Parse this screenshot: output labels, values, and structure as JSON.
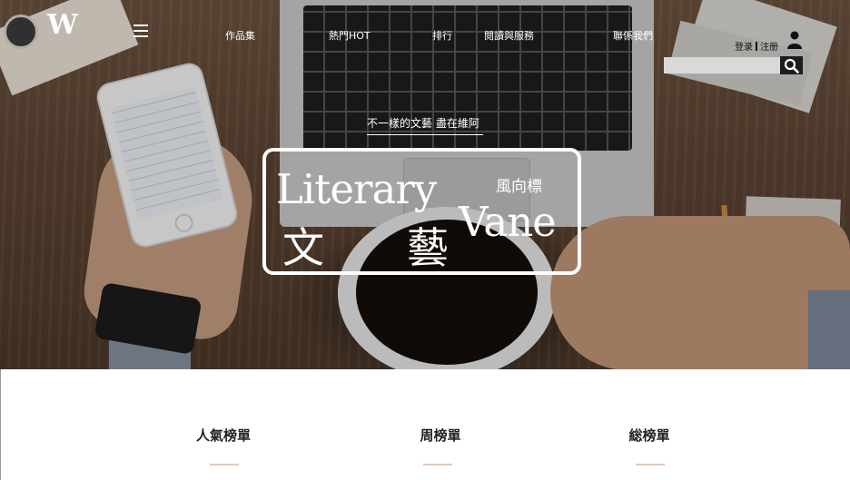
{
  "header": {
    "logo_text": "W",
    "nav": [
      "作品集",
      "熱門HOT",
      "排行",
      "閱讀與服務",
      "聯係我們"
    ],
    "auth": {
      "login": "登录",
      "register": "注册"
    },
    "search": {
      "placeholder": ""
    }
  },
  "hero": {
    "tagline": "不一樣的文藝 盡在維阿",
    "brand": {
      "english_1": "Literary",
      "english_2": "Vane",
      "chinese_1": "文",
      "chinese_2": "藝",
      "subtitle": "風向標"
    }
  },
  "rankings": [
    {
      "title": "人氣榜單"
    },
    {
      "title": "周榜單"
    },
    {
      "title": "総榜單"
    }
  ],
  "colors": {
    "accent_underline": "#e7c9b8",
    "search_button": "#1c1c1c"
  },
  "icons": [
    "hamburger-menu-icon",
    "user-icon",
    "search-icon"
  ]
}
